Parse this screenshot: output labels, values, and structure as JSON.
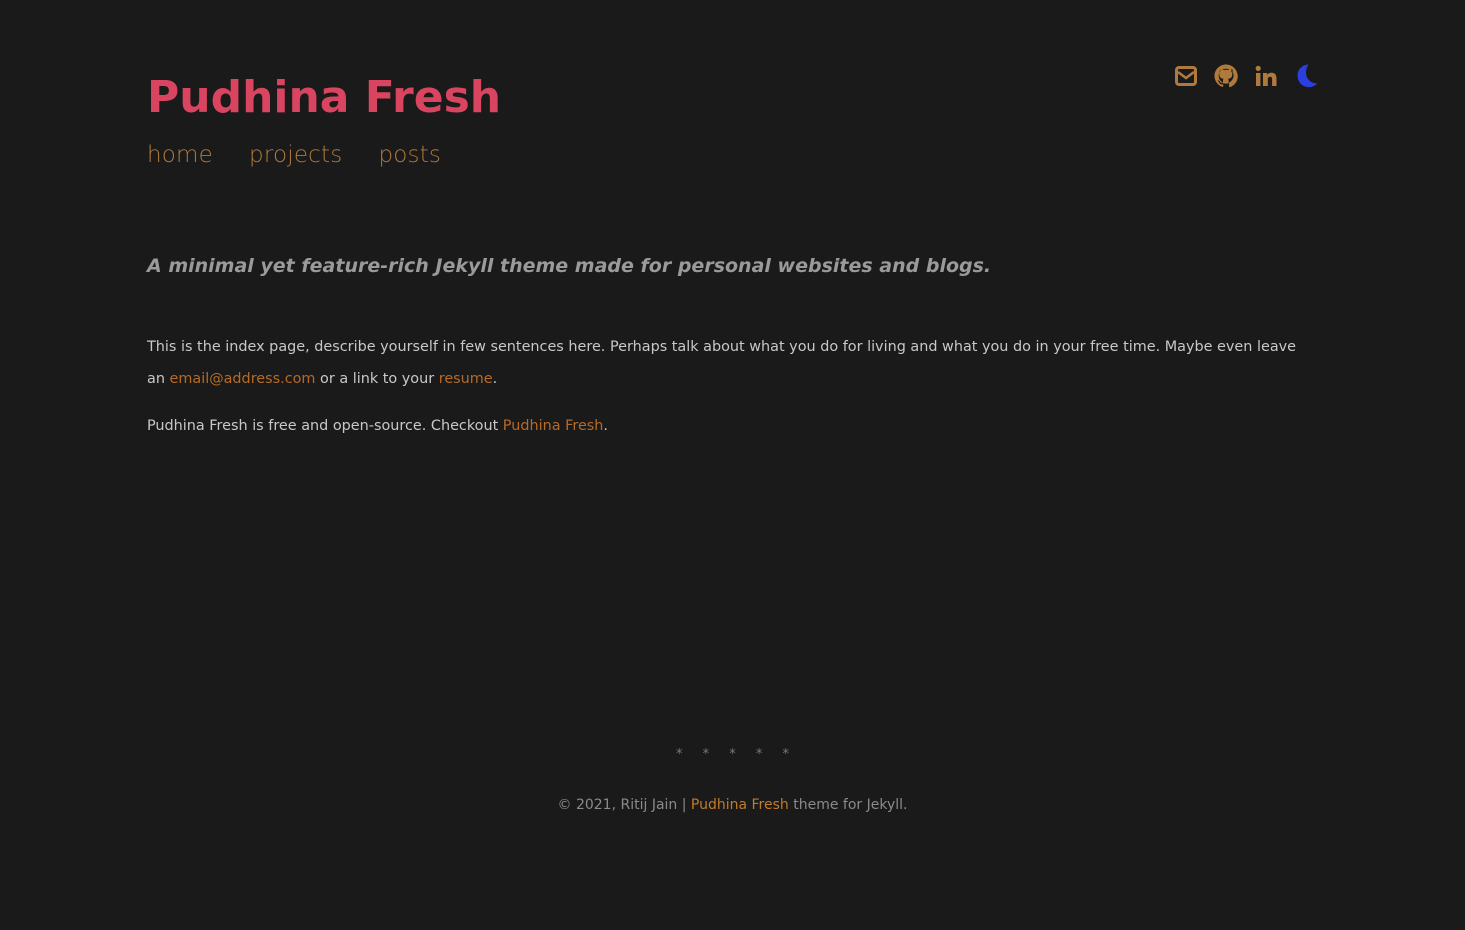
{
  "header": {
    "site_title": "Pudhina Fresh",
    "nav": [
      "home",
      "projects",
      "posts"
    ],
    "social_icons": [
      "envelope-icon",
      "github-icon",
      "linkedin-icon",
      "moon-icon"
    ]
  },
  "main": {
    "tagline": "A minimal yet feature-rich Jekyll theme made for personal websites and blogs.",
    "intro_text": "This is the index page, describe yourself in few sentences here. Perhaps talk about what you do for living and what you do in your free time. Maybe even leave an",
    "email_link": "email@address.com",
    "intro_middle": " or a link to your ",
    "resume_link": "resume",
    "intro_end": ".",
    "oss_text": "Pudhina Fresh is free and open-source. Checkout ",
    "oss_link": "Pudhina Fresh",
    "oss_end": "."
  },
  "footer": {
    "separator": "* * * * *",
    "copyright_prefix": "© 2021, Ritij Jain | ",
    "theme_link": "Pudhina Fresh",
    "copyright_suffix": " theme for Jekyll."
  },
  "colors": {
    "background": "#1a1a1a",
    "title": "#d94560",
    "nav": "#b07a3c",
    "link": "#b56a28",
    "icon": "#b07a3c",
    "moon": "#2a3fe0"
  }
}
